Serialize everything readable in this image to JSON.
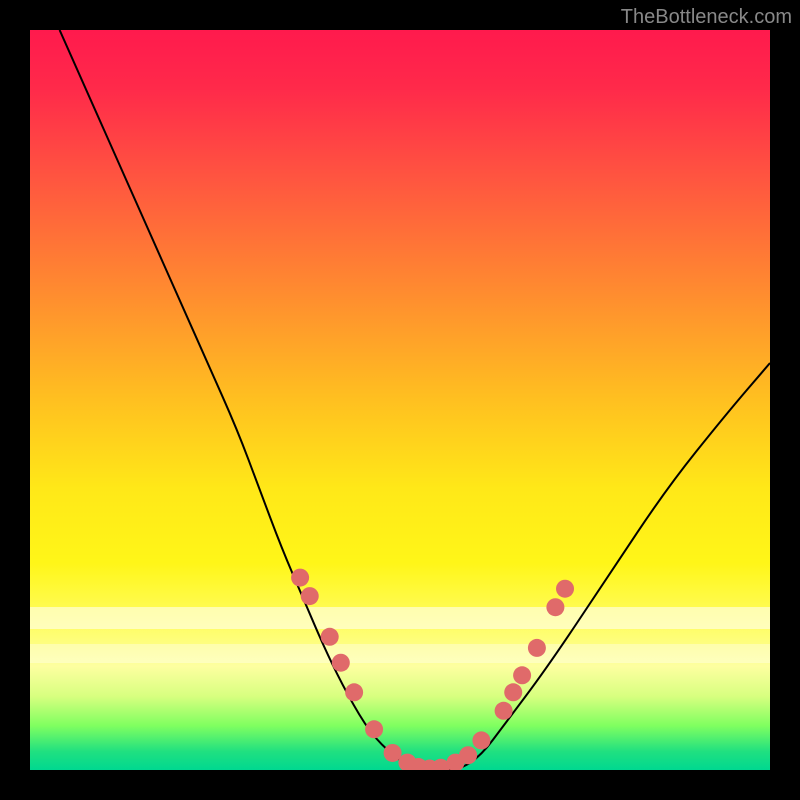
{
  "watermark": "TheBottleneck.com",
  "chart_data": {
    "type": "line",
    "title": "",
    "xlabel": "",
    "ylabel": "",
    "x_range": [
      0,
      100
    ],
    "y_range": [
      0,
      100
    ],
    "gradient_zones": [
      {
        "pct": 0,
        "color": "#ff1a4d",
        "meaning": "severe-bottleneck"
      },
      {
        "pct": 35,
        "color": "#ff8a30",
        "meaning": "high-bottleneck"
      },
      {
        "pct": 62,
        "color": "#ffe818",
        "meaning": "moderate-bottleneck"
      },
      {
        "pct": 86,
        "color": "#fdffa0",
        "meaning": "mild-bottleneck"
      },
      {
        "pct": 97,
        "color": "#20e080",
        "meaning": "no-bottleneck"
      }
    ],
    "series": [
      {
        "name": "bottleneck-curve",
        "x": [
          4,
          8,
          12,
          16,
          20,
          24,
          28,
          31,
          34,
          37,
          40,
          43,
          46,
          49,
          52,
          55,
          58,
          61,
          64,
          70,
          78,
          86,
          94,
          100
        ],
        "y": [
          100,
          91,
          82,
          73,
          64,
          55,
          46,
          38,
          30,
          23,
          16,
          10,
          5,
          2,
          0,
          0,
          0,
          2,
          6,
          14,
          26,
          38,
          48,
          55
        ]
      }
    ],
    "markers": {
      "name": "highlight-points",
      "points": [
        {
          "x": 36.5,
          "y": 26
        },
        {
          "x": 37.8,
          "y": 23.5
        },
        {
          "x": 40.5,
          "y": 18
        },
        {
          "x": 42.0,
          "y": 14.5
        },
        {
          "x": 43.8,
          "y": 10.5
        },
        {
          "x": 46.5,
          "y": 5.5
        },
        {
          "x": 49.0,
          "y": 2.3
        },
        {
          "x": 51.0,
          "y": 1.0
        },
        {
          "x": 52.5,
          "y": 0.4
        },
        {
          "x": 54.0,
          "y": 0.2
        },
        {
          "x": 55.5,
          "y": 0.3
        },
        {
          "x": 57.5,
          "y": 1.0
        },
        {
          "x": 59.2,
          "y": 2.0
        },
        {
          "x": 61.0,
          "y": 4.0
        },
        {
          "x": 64.0,
          "y": 8.0
        },
        {
          "x": 65.3,
          "y": 10.5
        },
        {
          "x": 66.5,
          "y": 12.8
        },
        {
          "x": 68.5,
          "y": 16.5
        },
        {
          "x": 71.0,
          "y": 22.0
        },
        {
          "x": 72.3,
          "y": 24.5
        }
      ]
    }
  }
}
